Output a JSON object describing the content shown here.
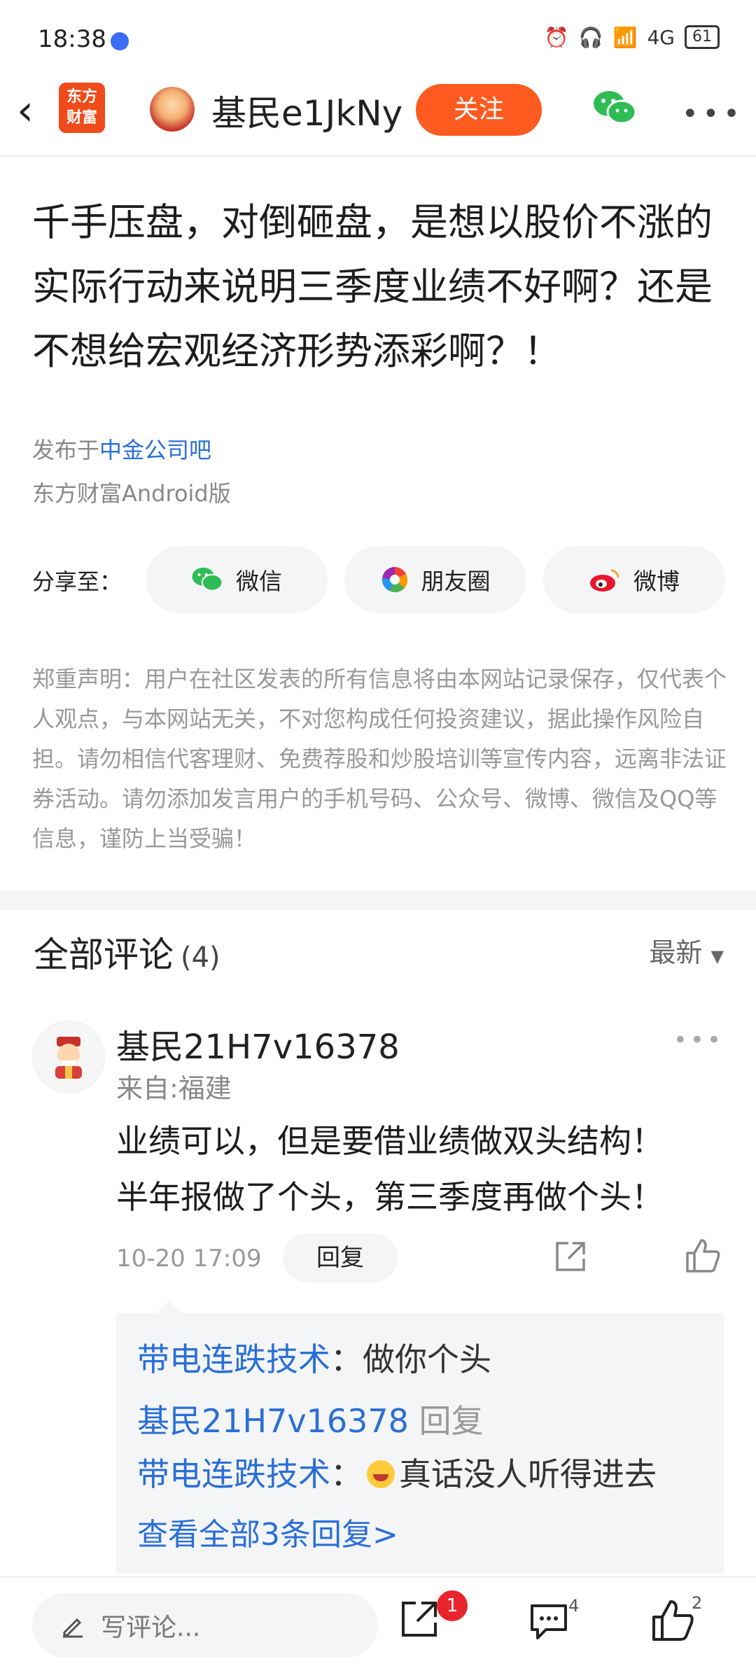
{
  "status_bar": {
    "time": "18:38",
    "battery": "61",
    "network": "4G"
  },
  "nav": {
    "logo_line1": "东方",
    "logo_line2": "财富",
    "username": "基民e1JkNy",
    "follow_label": "关注"
  },
  "post": {
    "title": "千手压盘，对倒砸盘，是想以股价不涨的实际行动来说明三季度业绩不好啊？还是不想给宏观经济形势添彩啊？！",
    "published_prefix": "发布于",
    "forum_name": "中金公司吧",
    "client": "东方财富Android版"
  },
  "share": {
    "label": "分享至：",
    "wechat": "微信",
    "moments": "朋友圈",
    "weibo": "微博"
  },
  "disclaimer": "郑重声明：用户在社区发表的所有信息将由本网站记录保存，仅代表个人观点，与本网站无关，不对您构成任何投资建议，据此操作风险自担。请勿相信代客理财、免费荐股和炒股培训等宣传内容，远离非法证券活动。请勿添加发言用户的手机号码、公众号、微博、微信及QQ等信息，谨防上当受骗！",
  "comments": {
    "title": "全部评论",
    "count": "(4)",
    "sort": "最新",
    "items": [
      {
        "user": "基民21H7v16378",
        "location": "来自:福建",
        "text_line1": "业绩可以，但是要借业绩做双头结构！",
        "text_line2": "半年报做了个头，第三季度再做个头！",
        "time": "10-20 17:09",
        "reply_label": "回复",
        "replies": [
          {
            "user": "带电连跌技术",
            "sep": "：",
            "text": "做你个头"
          },
          {
            "user": "基民21H7v16378",
            "action": "回复"
          },
          {
            "user": "带电连跌技术",
            "sep": "：",
            "text": "真话没人听得进去"
          }
        ],
        "view_all": "查看全部3条回复>"
      }
    ]
  },
  "bottom_bar": {
    "input_placeholder": "写评论...",
    "share_badge": "1",
    "comment_count": "4",
    "like_count": "2"
  }
}
